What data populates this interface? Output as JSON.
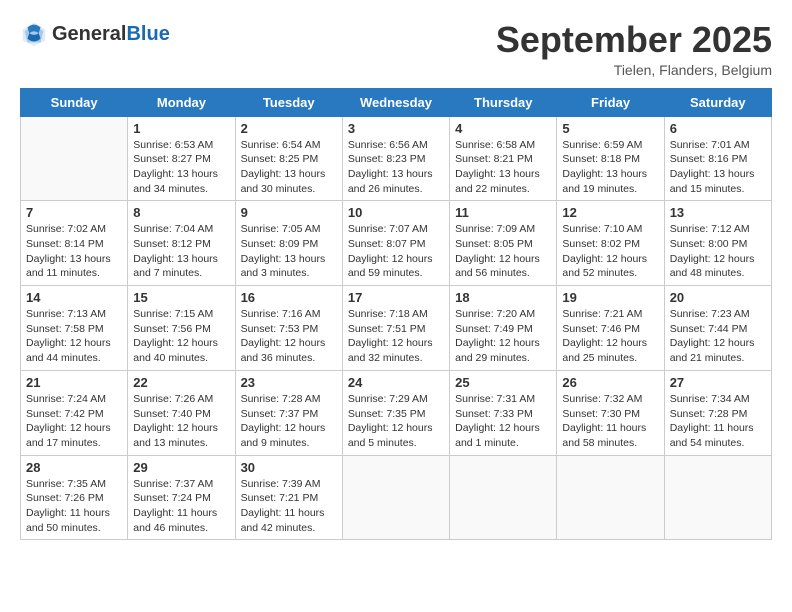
{
  "header": {
    "logo_general": "General",
    "logo_blue": "Blue",
    "month_title": "September 2025",
    "location": "Tielen, Flanders, Belgium"
  },
  "days_of_week": [
    "Sunday",
    "Monday",
    "Tuesday",
    "Wednesday",
    "Thursday",
    "Friday",
    "Saturday"
  ],
  "weeks": [
    [
      {
        "num": "",
        "sunrise": "",
        "sunset": "",
        "daylight": ""
      },
      {
        "num": "1",
        "sunrise": "Sunrise: 6:53 AM",
        "sunset": "Sunset: 8:27 PM",
        "daylight": "Daylight: 13 hours and 34 minutes."
      },
      {
        "num": "2",
        "sunrise": "Sunrise: 6:54 AM",
        "sunset": "Sunset: 8:25 PM",
        "daylight": "Daylight: 13 hours and 30 minutes."
      },
      {
        "num": "3",
        "sunrise": "Sunrise: 6:56 AM",
        "sunset": "Sunset: 8:23 PM",
        "daylight": "Daylight: 13 hours and 26 minutes."
      },
      {
        "num": "4",
        "sunrise": "Sunrise: 6:58 AM",
        "sunset": "Sunset: 8:21 PM",
        "daylight": "Daylight: 13 hours and 22 minutes."
      },
      {
        "num": "5",
        "sunrise": "Sunrise: 6:59 AM",
        "sunset": "Sunset: 8:18 PM",
        "daylight": "Daylight: 13 hours and 19 minutes."
      },
      {
        "num": "6",
        "sunrise": "Sunrise: 7:01 AM",
        "sunset": "Sunset: 8:16 PM",
        "daylight": "Daylight: 13 hours and 15 minutes."
      }
    ],
    [
      {
        "num": "7",
        "sunrise": "Sunrise: 7:02 AM",
        "sunset": "Sunset: 8:14 PM",
        "daylight": "Daylight: 13 hours and 11 minutes."
      },
      {
        "num": "8",
        "sunrise": "Sunrise: 7:04 AM",
        "sunset": "Sunset: 8:12 PM",
        "daylight": "Daylight: 13 hours and 7 minutes."
      },
      {
        "num": "9",
        "sunrise": "Sunrise: 7:05 AM",
        "sunset": "Sunset: 8:09 PM",
        "daylight": "Daylight: 13 hours and 3 minutes."
      },
      {
        "num": "10",
        "sunrise": "Sunrise: 7:07 AM",
        "sunset": "Sunset: 8:07 PM",
        "daylight": "Daylight: 12 hours and 59 minutes."
      },
      {
        "num": "11",
        "sunrise": "Sunrise: 7:09 AM",
        "sunset": "Sunset: 8:05 PM",
        "daylight": "Daylight: 12 hours and 56 minutes."
      },
      {
        "num": "12",
        "sunrise": "Sunrise: 7:10 AM",
        "sunset": "Sunset: 8:02 PM",
        "daylight": "Daylight: 12 hours and 52 minutes."
      },
      {
        "num": "13",
        "sunrise": "Sunrise: 7:12 AM",
        "sunset": "Sunset: 8:00 PM",
        "daylight": "Daylight: 12 hours and 48 minutes."
      }
    ],
    [
      {
        "num": "14",
        "sunrise": "Sunrise: 7:13 AM",
        "sunset": "Sunset: 7:58 PM",
        "daylight": "Daylight: 12 hours and 44 minutes."
      },
      {
        "num": "15",
        "sunrise": "Sunrise: 7:15 AM",
        "sunset": "Sunset: 7:56 PM",
        "daylight": "Daylight: 12 hours and 40 minutes."
      },
      {
        "num": "16",
        "sunrise": "Sunrise: 7:16 AM",
        "sunset": "Sunset: 7:53 PM",
        "daylight": "Daylight: 12 hours and 36 minutes."
      },
      {
        "num": "17",
        "sunrise": "Sunrise: 7:18 AM",
        "sunset": "Sunset: 7:51 PM",
        "daylight": "Daylight: 12 hours and 32 minutes."
      },
      {
        "num": "18",
        "sunrise": "Sunrise: 7:20 AM",
        "sunset": "Sunset: 7:49 PM",
        "daylight": "Daylight: 12 hours and 29 minutes."
      },
      {
        "num": "19",
        "sunrise": "Sunrise: 7:21 AM",
        "sunset": "Sunset: 7:46 PM",
        "daylight": "Daylight: 12 hours and 25 minutes."
      },
      {
        "num": "20",
        "sunrise": "Sunrise: 7:23 AM",
        "sunset": "Sunset: 7:44 PM",
        "daylight": "Daylight: 12 hours and 21 minutes."
      }
    ],
    [
      {
        "num": "21",
        "sunrise": "Sunrise: 7:24 AM",
        "sunset": "Sunset: 7:42 PM",
        "daylight": "Daylight: 12 hours and 17 minutes."
      },
      {
        "num": "22",
        "sunrise": "Sunrise: 7:26 AM",
        "sunset": "Sunset: 7:40 PM",
        "daylight": "Daylight: 12 hours and 13 minutes."
      },
      {
        "num": "23",
        "sunrise": "Sunrise: 7:28 AM",
        "sunset": "Sunset: 7:37 PM",
        "daylight": "Daylight: 12 hours and 9 minutes."
      },
      {
        "num": "24",
        "sunrise": "Sunrise: 7:29 AM",
        "sunset": "Sunset: 7:35 PM",
        "daylight": "Daylight: 12 hours and 5 minutes."
      },
      {
        "num": "25",
        "sunrise": "Sunrise: 7:31 AM",
        "sunset": "Sunset: 7:33 PM",
        "daylight": "Daylight: 12 hours and 1 minute."
      },
      {
        "num": "26",
        "sunrise": "Sunrise: 7:32 AM",
        "sunset": "Sunset: 7:30 PM",
        "daylight": "Daylight: 11 hours and 58 minutes."
      },
      {
        "num": "27",
        "sunrise": "Sunrise: 7:34 AM",
        "sunset": "Sunset: 7:28 PM",
        "daylight": "Daylight: 11 hours and 54 minutes."
      }
    ],
    [
      {
        "num": "28",
        "sunrise": "Sunrise: 7:35 AM",
        "sunset": "Sunset: 7:26 PM",
        "daylight": "Daylight: 11 hours and 50 minutes."
      },
      {
        "num": "29",
        "sunrise": "Sunrise: 7:37 AM",
        "sunset": "Sunset: 7:24 PM",
        "daylight": "Daylight: 11 hours and 46 minutes."
      },
      {
        "num": "30",
        "sunrise": "Sunrise: 7:39 AM",
        "sunset": "Sunset: 7:21 PM",
        "daylight": "Daylight: 11 hours and 42 minutes."
      },
      {
        "num": "",
        "sunrise": "",
        "sunset": "",
        "daylight": ""
      },
      {
        "num": "",
        "sunrise": "",
        "sunset": "",
        "daylight": ""
      },
      {
        "num": "",
        "sunrise": "",
        "sunset": "",
        "daylight": ""
      },
      {
        "num": "",
        "sunrise": "",
        "sunset": "",
        "daylight": ""
      }
    ]
  ]
}
